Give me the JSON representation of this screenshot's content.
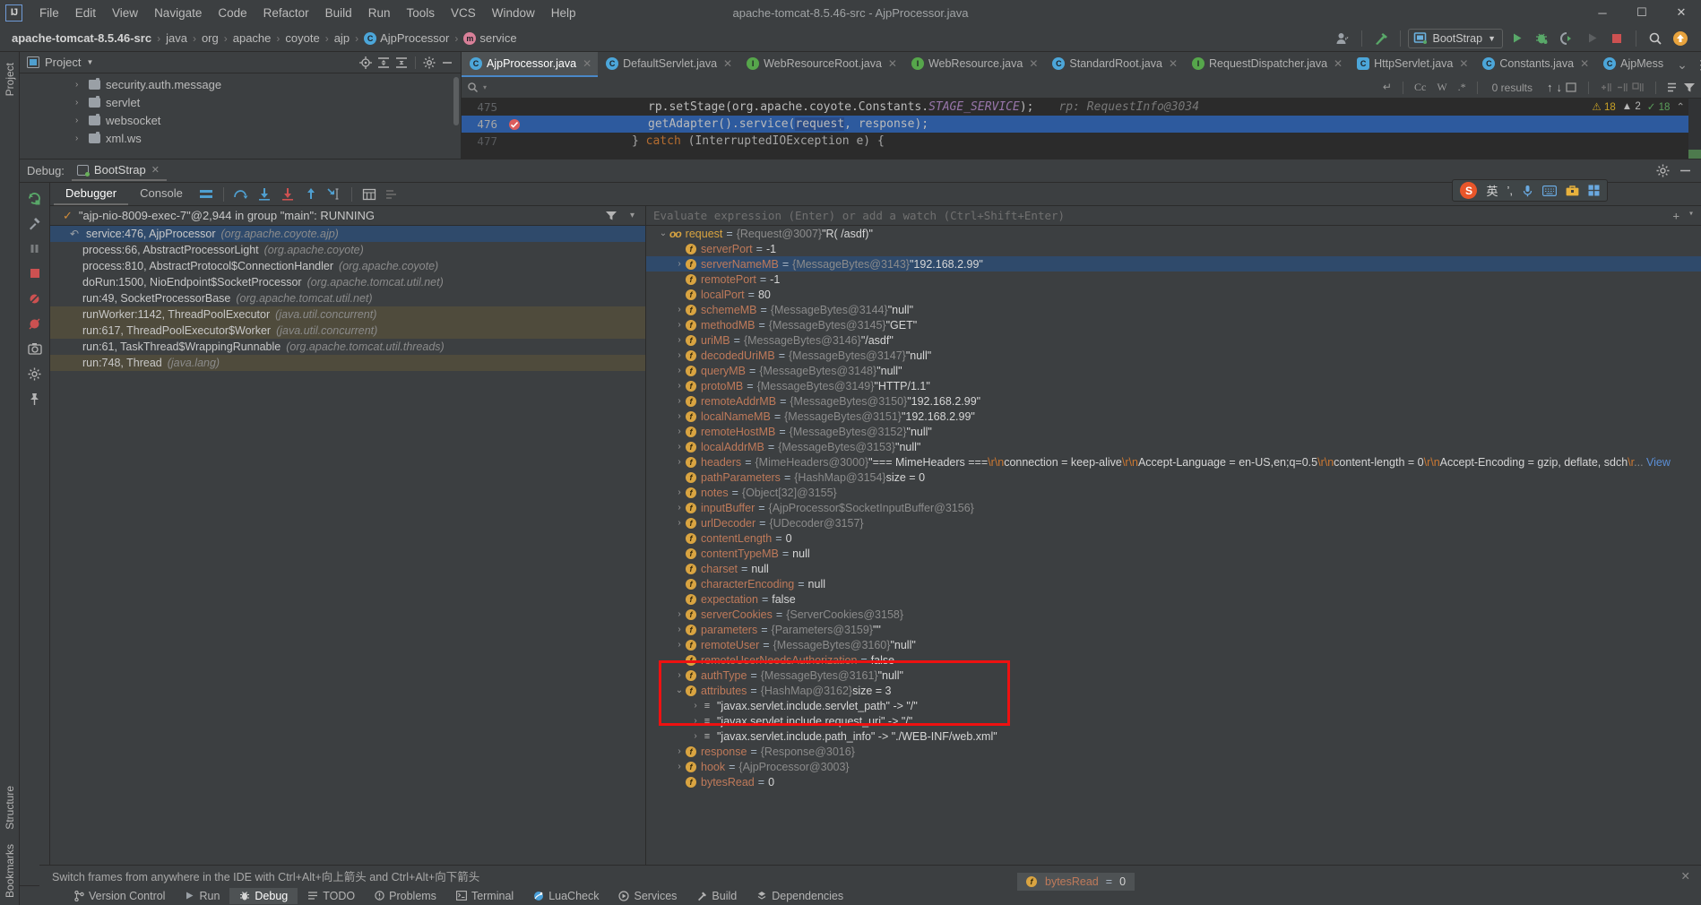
{
  "window": {
    "title": "apache-tomcat-8.5.46-src - AjpProcessor.java",
    "minimize": "─",
    "maximize": "☐",
    "close": "✕"
  },
  "menubar": {
    "logo": "IJ",
    "items": [
      "File",
      "Edit",
      "View",
      "Navigate",
      "Code",
      "Refactor",
      "Build",
      "Run",
      "Tools",
      "VCS",
      "Window",
      "Help"
    ]
  },
  "navbar": {
    "crumbs": [
      {
        "label": "apache-tomcat-8.5.46-src",
        "bold": true,
        "badge": ""
      },
      {
        "label": "java",
        "bold": false,
        "badge": ""
      },
      {
        "label": "org",
        "bold": false,
        "badge": ""
      },
      {
        "label": "apache",
        "bold": false,
        "badge": ""
      },
      {
        "label": "coyote",
        "bold": false,
        "badge": ""
      },
      {
        "label": "ajp",
        "bold": false,
        "badge": ""
      },
      {
        "label": "AjpProcessor",
        "bold": false,
        "badge": "C"
      },
      {
        "label": "service",
        "bold": false,
        "badge": "m"
      }
    ],
    "separator": "›",
    "run_config": "BootStrap",
    "icons": [
      "user-avatar-icon",
      "hammer-build-icon",
      "run-icon",
      "debug-icon",
      "run-with-coverage-icon",
      "rerun-icon",
      "stop-icon",
      "search-everywhere-icon",
      "update-icon"
    ]
  },
  "project_panel": {
    "title": "Project",
    "dropdown": "▼",
    "tools": [
      "locate-icon",
      "expand-all-icon",
      "collapse-all-icon",
      "settings-gear-icon",
      "hide-icon"
    ],
    "items": [
      {
        "label": "security.auth.message"
      },
      {
        "label": "servlet"
      },
      {
        "label": "websocket"
      },
      {
        "label": "xml.ws"
      }
    ]
  },
  "editor": {
    "tabs": [
      {
        "label": "AjpProcessor.java",
        "icon": "C",
        "kind": "c",
        "active": true
      },
      {
        "label": "DefaultServlet.java",
        "icon": "C",
        "kind": "c",
        "active": false
      },
      {
        "label": "WebResourceRoot.java",
        "icon": "I",
        "kind": "i",
        "active": false
      },
      {
        "label": "WebResource.java",
        "icon": "I",
        "kind": "i",
        "active": false
      },
      {
        "label": "StandardRoot.java",
        "icon": "C",
        "kind": "c",
        "active": false
      },
      {
        "label": "RequestDispatcher.java",
        "icon": "I",
        "kind": "i",
        "active": false
      },
      {
        "label": "HttpServlet.java",
        "icon": "C",
        "kind": "ic",
        "active": false
      },
      {
        "label": "Constants.java",
        "icon": "C",
        "kind": "c",
        "active": false
      },
      {
        "label": "AjpMess",
        "icon": "C",
        "kind": "c",
        "active": false
      }
    ],
    "tab_close": "✕",
    "tab_overflow": "⌄",
    "tab_menu": "⋮",
    "find": {
      "placeholder": "",
      "search_icon": "search-icon",
      "history_icon": "▾",
      "regex_return": "↵",
      "opt_case": "Cc",
      "opt_word": "W",
      "opt_regex": ".*",
      "results": "0 results",
      "prev": "↑",
      "next": "↓",
      "select_all": "select-all-icon",
      "add_icon": "add-selection-icon",
      "remove_icon": "remove-selection-icon",
      "select_occurrences_icon": "select-occurrences-icon",
      "filter_icon": "filter-icon",
      "list_icon": "list-results-icon"
    },
    "lines": [
      {
        "number": "475",
        "breakpoint": false,
        "highlight": false
      },
      {
        "number": "476",
        "breakpoint": true,
        "highlight": true
      },
      {
        "number": "477",
        "breakpoint": false,
        "highlight": false
      }
    ],
    "line475": {
      "code": "rp.setStage(org.apache.coyote.Constants.",
      "field": "STAGE_SERVICE",
      "tail": ");",
      "hint": "rp: RequestInfo@3034"
    },
    "line476": {
      "pre": "getAdapter().service(",
      "arg1": "request",
      "mid": ", ",
      "arg2": "response",
      "tail": ");"
    },
    "line477": {
      "pre": "} ",
      "kw": "catch",
      "mid": " (InterruptedIOException e) {"
    },
    "inspections": {
      "warnings": "18",
      "errors": "2",
      "oks": "18",
      "warn_icon": "warning-triangle-icon",
      "err_icon": "error-icon",
      "ok_icon": "checkmark-icon",
      "chevron": "⌃"
    }
  },
  "debug_window": {
    "label": "Debug:",
    "session_tab": "BootStrap",
    "close": "✕",
    "settings_icon": "settings-gear-icon",
    "hide_icon": "hide-icon",
    "left_buttons": [
      "rerun-icon",
      "modify-settings-icon",
      "pause-icon",
      "stop-icon",
      "mute-breakpoints-icon",
      "view-breakpoints-icon",
      "camera-icon",
      "settings-icon",
      "pin-icon"
    ],
    "toolbar_tabs": [
      {
        "label": "Debugger",
        "active": true
      },
      {
        "label": "Console",
        "active": false
      }
    ],
    "toolbar_icons": [
      "layout-icon",
      "step-over-icon",
      "step-into-icon",
      "force-step-into-icon",
      "step-out-icon",
      "run-to-cursor-icon",
      "evaluate-icon",
      "threads-icon"
    ],
    "thread": {
      "status_icon": "✓",
      "text": "\"ajp-nio-8009-exec-7\"@2,944 in group \"main\": RUNNING",
      "filter_icon": "filter-icon",
      "dropdown_icon": "▾"
    },
    "frames": [
      {
        "method": "service:476, AjpProcessor",
        "pkg": "(org.apache.coyote.ajp)",
        "selected": true,
        "tan": false,
        "arrow": "↶"
      },
      {
        "method": "process:66, AbstractProcessorLight",
        "pkg": "(org.apache.coyote)",
        "selected": false,
        "tan": false,
        "arrow": ""
      },
      {
        "method": "process:810, AbstractProtocol$ConnectionHandler",
        "pkg": "(org.apache.coyote)",
        "selected": false,
        "tan": false,
        "arrow": ""
      },
      {
        "method": "doRun:1500, NioEndpoint$SocketProcessor",
        "pkg": "(org.apache.tomcat.util.net)",
        "selected": false,
        "tan": false,
        "arrow": ""
      },
      {
        "method": "run:49, SocketProcessorBase",
        "pkg": "(org.apache.tomcat.util.net)",
        "selected": false,
        "tan": false,
        "arrow": ""
      },
      {
        "method": "runWorker:1142, ThreadPoolExecutor",
        "pkg": "(java.util.concurrent)",
        "selected": false,
        "tan": true,
        "arrow": ""
      },
      {
        "method": "run:617, ThreadPoolExecutor$Worker",
        "pkg": "(java.util.concurrent)",
        "selected": false,
        "tan": true,
        "arrow": ""
      },
      {
        "method": "run:61, TaskThread$WrappingRunnable",
        "pkg": "(org.apache.tomcat.util.threads)",
        "selected": false,
        "tan": false,
        "arrow": ""
      },
      {
        "method": "run:748, Thread",
        "pkg": "(java.lang)",
        "selected": false,
        "tan": true,
        "arrow": ""
      }
    ],
    "watch_placeholder": "Evaluate expression (Enter) or add a watch (Ctrl+Shift+Enter)",
    "watch_add": "+",
    "watch_dropdown": "▾",
    "variables": [
      {
        "indent": 0,
        "arrow": "⌄",
        "icon": "oo",
        "name": "request",
        "eq": "=",
        "type": "{Request@3007}",
        "value": "\"R( /asdf)\"",
        "selected": false
      },
      {
        "indent": 1,
        "arrow": "",
        "icon": "f",
        "name": "serverPort",
        "eq": "=",
        "type": "",
        "value": "-1",
        "selected": false
      },
      {
        "indent": 1,
        "arrow": "›",
        "icon": "f",
        "name": "serverNameMB",
        "eq": "=",
        "type": "{MessageBytes@3143}",
        "value": "\"192.168.2.99\"",
        "selected": true
      },
      {
        "indent": 1,
        "arrow": "",
        "icon": "f",
        "name": "remotePort",
        "eq": "=",
        "type": "",
        "value": "-1",
        "selected": false
      },
      {
        "indent": 1,
        "arrow": "",
        "icon": "f",
        "name": "localPort",
        "eq": "=",
        "type": "",
        "value": "80",
        "selected": false
      },
      {
        "indent": 1,
        "arrow": "›",
        "icon": "f",
        "name": "schemeMB",
        "eq": "=",
        "type": "{MessageBytes@3144}",
        "value": "\"null\"",
        "selected": false
      },
      {
        "indent": 1,
        "arrow": "›",
        "icon": "f",
        "name": "methodMB",
        "eq": "=",
        "type": "{MessageBytes@3145}",
        "value": "\"GET\"",
        "selected": false
      },
      {
        "indent": 1,
        "arrow": "›",
        "icon": "f",
        "name": "uriMB",
        "eq": "=",
        "type": "{MessageBytes@3146}",
        "value": "\"/asdf\"",
        "selected": false
      },
      {
        "indent": 1,
        "arrow": "›",
        "icon": "f",
        "name": "decodedUriMB",
        "eq": "=",
        "type": "{MessageBytes@3147}",
        "value": "\"null\"",
        "selected": false
      },
      {
        "indent": 1,
        "arrow": "›",
        "icon": "f",
        "name": "queryMB",
        "eq": "=",
        "type": "{MessageBytes@3148}",
        "value": "\"null\"",
        "selected": false
      },
      {
        "indent": 1,
        "arrow": "›",
        "icon": "f",
        "name": "protoMB",
        "eq": "=",
        "type": "{MessageBytes@3149}",
        "value": "\"HTTP/1.1\"",
        "selected": false
      },
      {
        "indent": 1,
        "arrow": "›",
        "icon": "f",
        "name": "remoteAddrMB",
        "eq": "=",
        "type": "{MessageBytes@3150}",
        "value": "\"192.168.2.99\"",
        "selected": false
      },
      {
        "indent": 1,
        "arrow": "›",
        "icon": "f",
        "name": "localNameMB",
        "eq": "=",
        "type": "{MessageBytes@3151}",
        "value": "\"192.168.2.99\"",
        "selected": false
      },
      {
        "indent": 1,
        "arrow": "›",
        "icon": "f",
        "name": "remoteHostMB",
        "eq": "=",
        "type": "{MessageBytes@3152}",
        "value": "\"null\"",
        "selected": false
      },
      {
        "indent": 1,
        "arrow": "›",
        "icon": "f",
        "name": "localAddrMB",
        "eq": "=",
        "type": "{MessageBytes@3153}",
        "value": "\"null\"",
        "selected": false
      },
      {
        "indent": 1,
        "arrow": "›",
        "icon": "f",
        "name": "headers",
        "eq": "=",
        "type": "{MimeHeaders@3000}",
        "value": "HEADERS_SPECIAL",
        "selected": false
      },
      {
        "indent": 1,
        "arrow": "",
        "icon": "f",
        "name": "pathParameters",
        "eq": "=",
        "type": "{HashMap@3154}",
        "value": "size = 0",
        "selected": false
      },
      {
        "indent": 1,
        "arrow": "›",
        "icon": "f",
        "name": "notes",
        "eq": "=",
        "type": "{Object[32]@3155}",
        "value": "",
        "selected": false
      },
      {
        "indent": 1,
        "arrow": "›",
        "icon": "f",
        "name": "inputBuffer",
        "eq": "=",
        "type": "{AjpProcessor$SocketInputBuffer@3156}",
        "value": "",
        "selected": false
      },
      {
        "indent": 1,
        "arrow": "›",
        "icon": "f",
        "name": "urlDecoder",
        "eq": "=",
        "type": "{UDecoder@3157}",
        "value": "",
        "selected": false
      },
      {
        "indent": 1,
        "arrow": "",
        "icon": "f",
        "name": "contentLength",
        "eq": "=",
        "type": "",
        "value": "0",
        "selected": false
      },
      {
        "indent": 1,
        "arrow": "",
        "icon": "f",
        "name": "contentTypeMB",
        "eq": "=",
        "type": "",
        "value": "null",
        "selected": false
      },
      {
        "indent": 1,
        "arrow": "",
        "icon": "f",
        "name": "charset",
        "eq": "=",
        "type": "",
        "value": "null",
        "selected": false
      },
      {
        "indent": 1,
        "arrow": "",
        "icon": "f",
        "name": "characterEncoding",
        "eq": "=",
        "type": "",
        "value": "null",
        "selected": false
      },
      {
        "indent": 1,
        "arrow": "",
        "icon": "f",
        "name": "expectation",
        "eq": "=",
        "type": "",
        "value": "false",
        "selected": false
      },
      {
        "indent": 1,
        "arrow": "›",
        "icon": "f",
        "name": "serverCookies",
        "eq": "=",
        "type": "{ServerCookies@3158}",
        "value": "",
        "selected": false
      },
      {
        "indent": 1,
        "arrow": "›",
        "icon": "f",
        "name": "parameters",
        "eq": "=",
        "type": "{Parameters@3159}",
        "value": "\"\"",
        "selected": false
      },
      {
        "indent": 1,
        "arrow": "›",
        "icon": "f",
        "name": "remoteUser",
        "eq": "=",
        "type": "{MessageBytes@3160}",
        "value": "\"null\"",
        "selected": false
      },
      {
        "indent": 1,
        "arrow": "",
        "icon": "f",
        "name": "remoteUserNeedsAuthorization",
        "eq": "=",
        "type": "",
        "value": "false",
        "selected": false
      },
      {
        "indent": 1,
        "arrow": "›",
        "icon": "f",
        "name": "authType",
        "eq": "=",
        "type": "{MessageBytes@3161}",
        "value": "\"null\"",
        "selected": false
      },
      {
        "indent": 1,
        "arrow": "⌄",
        "icon": "f",
        "name": "attributes",
        "eq": "=",
        "type": "{HashMap@3162}",
        "value": "size = 3",
        "selected": false
      },
      {
        "indent": 2,
        "arrow": "›",
        "icon": "map",
        "name": "",
        "eq": "",
        "type": "",
        "value": "\"javax.servlet.include.servlet_path\" -> \"/\"",
        "selected": false
      },
      {
        "indent": 2,
        "arrow": "›",
        "icon": "map",
        "name": "",
        "eq": "",
        "type": "",
        "value": "\"javax.servlet.include.request_uri\" -> \"/\"",
        "selected": false
      },
      {
        "indent": 2,
        "arrow": "›",
        "icon": "map",
        "name": "",
        "eq": "",
        "type": "",
        "value": "\"javax.servlet.include.path_info\" -> \"./WEB-INF/web.xml\"",
        "selected": false
      },
      {
        "indent": 1,
        "arrow": "›",
        "icon": "f",
        "name": "response",
        "eq": "=",
        "type": "{Response@3016}",
        "value": "",
        "selected": false
      },
      {
        "indent": 1,
        "arrow": "›",
        "icon": "f",
        "name": "hook",
        "eq": "=",
        "type": "{AjpProcessor@3003}",
        "value": "",
        "selected": false
      },
      {
        "indent": 1,
        "arrow": "",
        "icon": "f",
        "name": "bytesRead",
        "eq": "=",
        "type": "",
        "value": "0",
        "selected": false
      }
    ],
    "headers_value": {
      "p1": "\"=== MimeHeaders ===",
      "esc1": "\\r\\n",
      "p2": "connection = keep-alive",
      "esc2": "\\r\\n",
      "p3": "Accept-Language = en-US,en;q=0.5",
      "esc3": "\\r\\n",
      "p4": "content-length = 0",
      "esc4": "\\r\\n",
      "p5": "Accept-Encoding = gzip, deflate, sdch",
      "esc5": "\\r",
      "ellipsis": "...",
      "link": "View"
    },
    "floating_var": {
      "icon": "f",
      "name": "bytesRead",
      "eq": "=",
      "value": "0"
    }
  },
  "left_strip": {
    "top": [
      "Project"
    ],
    "bottom": [
      "Bookmarks",
      "Structure"
    ]
  },
  "hint_bar": {
    "text": "Switch frames from anywhere in the IDE with Ctrl+Alt+向上箭头 and Ctrl+Alt+向下箭头",
    "close": "✕"
  },
  "status_bar": {
    "tabs": [
      {
        "label": "Version Control",
        "icon": "branch-icon",
        "active": false
      },
      {
        "label": "Run",
        "icon": "run-icon",
        "active": false
      },
      {
        "label": "Debug",
        "icon": "debug-icon",
        "active": true
      },
      {
        "label": "TODO",
        "icon": "todo-icon",
        "active": false
      },
      {
        "label": "Problems",
        "icon": "problems-icon",
        "active": false
      },
      {
        "label": "Terminal",
        "icon": "terminal-icon",
        "active": false
      },
      {
        "label": "LuaCheck",
        "icon": "luacheck-icon",
        "active": false
      },
      {
        "label": "Services",
        "icon": "services-icon",
        "active": false
      },
      {
        "label": "Build",
        "icon": "build-hammer-icon",
        "active": false
      },
      {
        "label": "Dependencies",
        "icon": "dependencies-icon",
        "active": false
      }
    ]
  },
  "ime_toolbar": {
    "logo": "S",
    "mode": "英",
    "punct": "’,",
    "icons": [
      "mic-icon",
      "keyboard-icon",
      "toolbox-icon",
      "apps-icon"
    ]
  },
  "colors": {
    "bg": "#3c3f41",
    "editor_bg": "#2b2b2b",
    "selection_blue": "#2d5a9e",
    "accent_blue": "#4a88c7",
    "red_highlight": "#ee1111",
    "tan_frame": "#4f4b3c",
    "var_name": "#bf7a5a",
    "string_green": "#6a8759"
  }
}
